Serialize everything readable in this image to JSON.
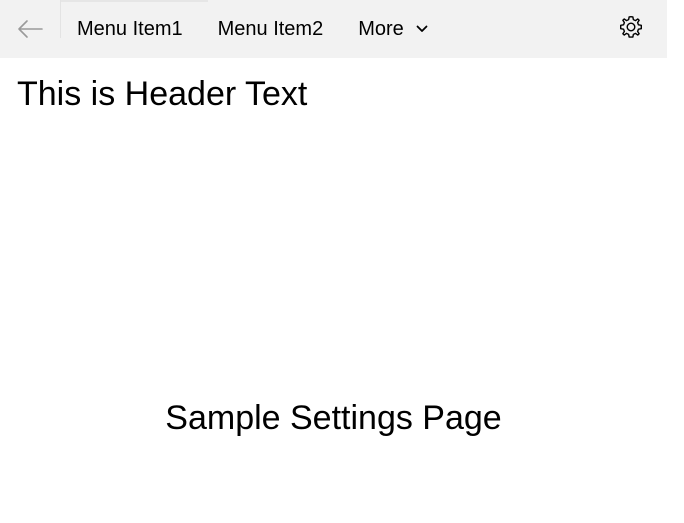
{
  "nav": {
    "back_icon": "back-arrow-icon",
    "menu_items": [
      {
        "label": "Menu Item1"
      },
      {
        "label": "Menu Item2"
      }
    ],
    "more_label": "More",
    "more_icon": "chevron-down-icon",
    "settings_icon": "gear-icon",
    "background_color": "#f2f2f2"
  },
  "header": {
    "text": "This is Header Text"
  },
  "content": {
    "text": "Sample Settings Page"
  }
}
